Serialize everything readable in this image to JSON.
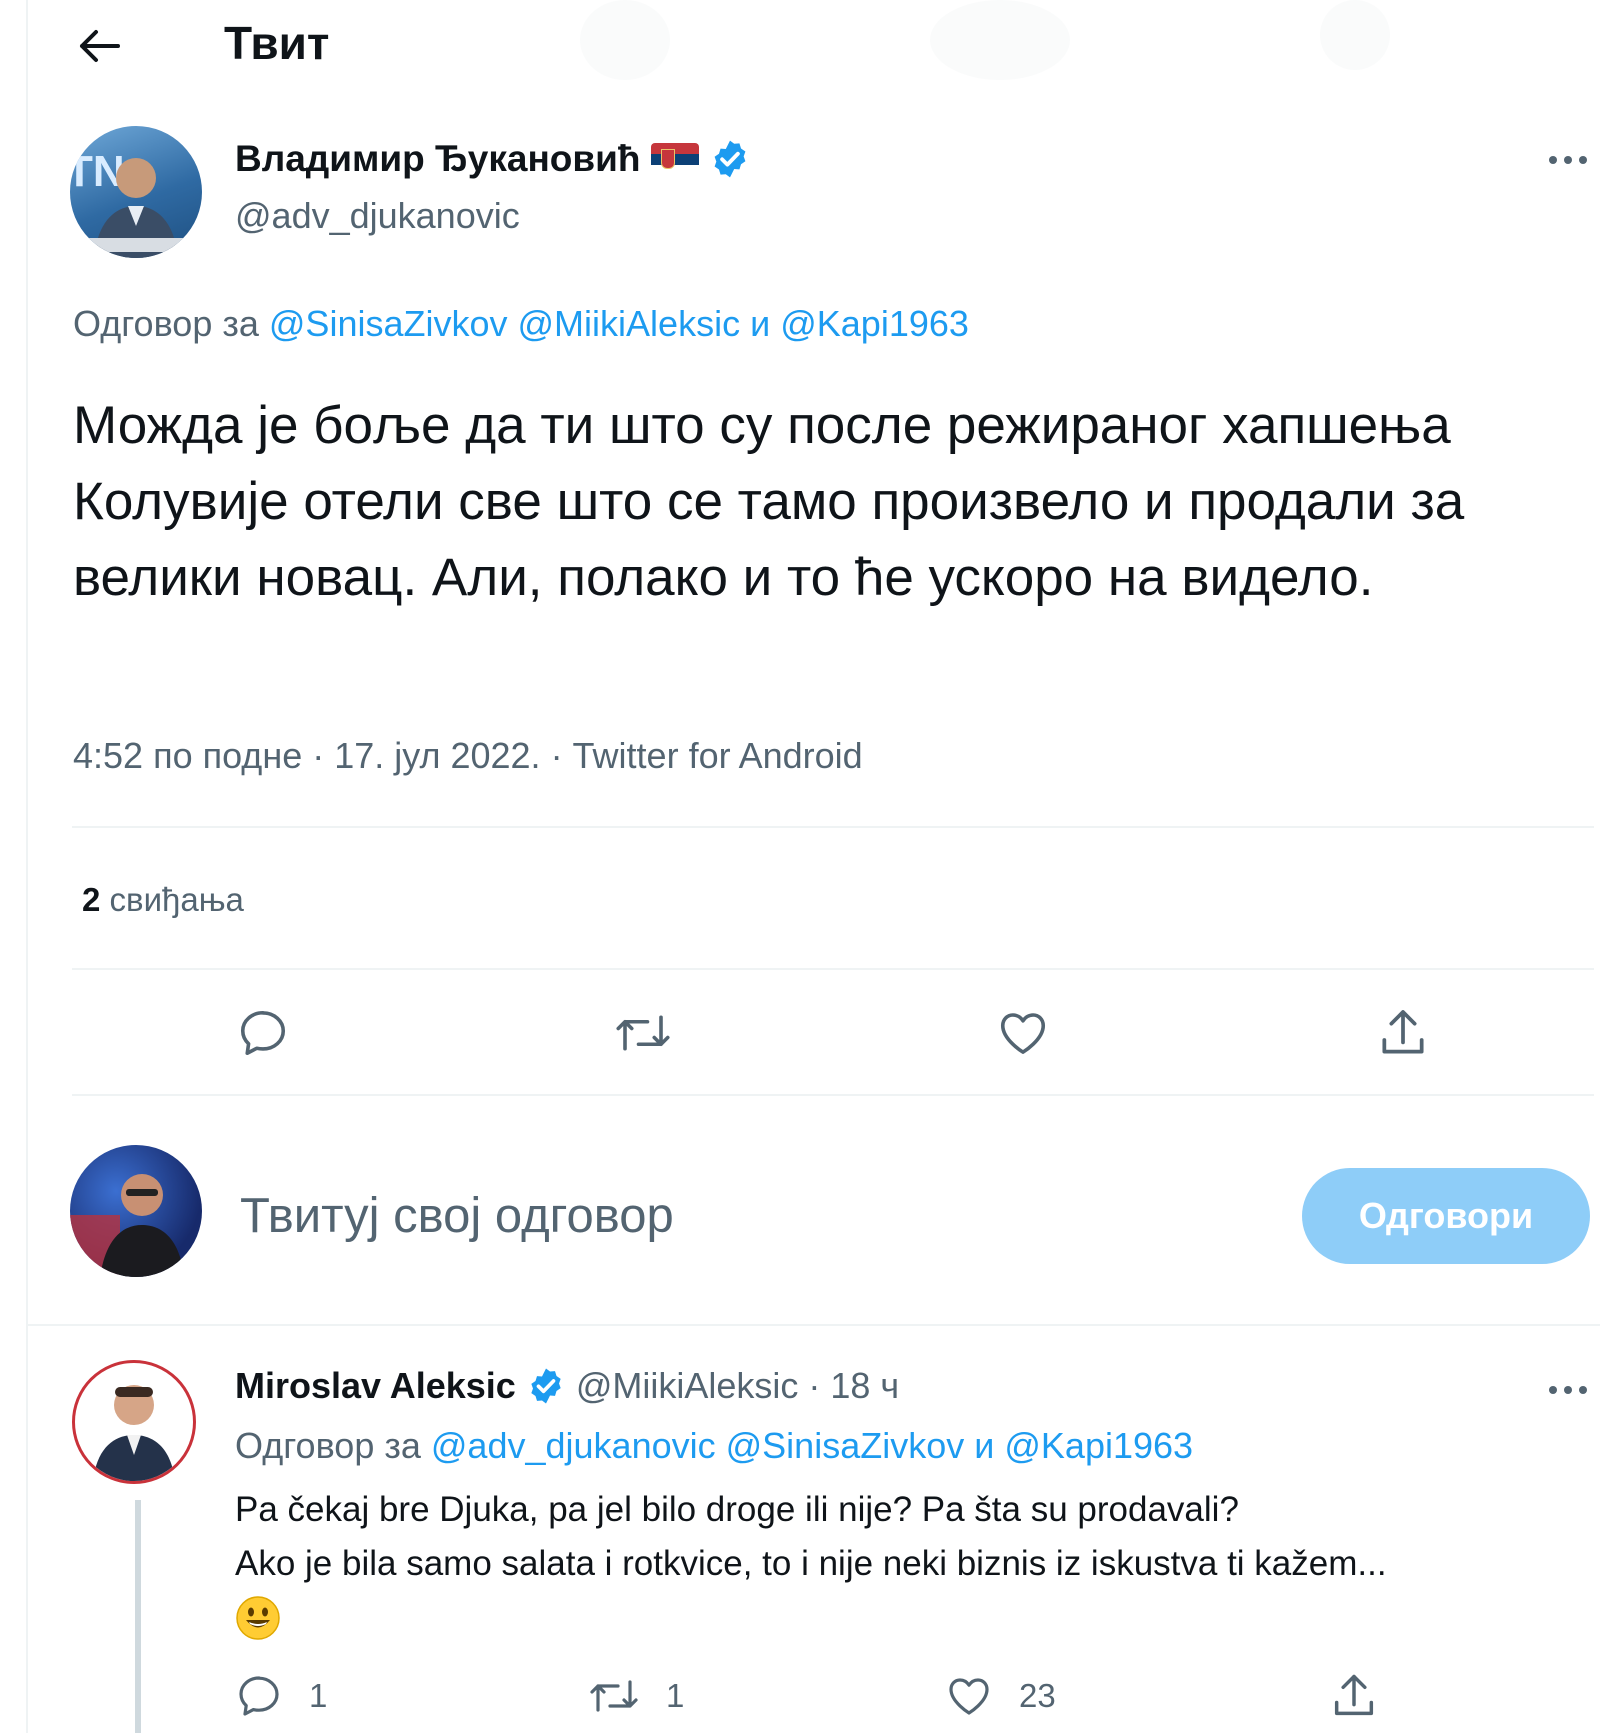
{
  "header": {
    "title": "Твит"
  },
  "tweet": {
    "author": {
      "name": "Владимир Ђукановић",
      "flag_icon": "serbia-flag-icon",
      "verified_icon": "verified-badge-icon",
      "handle": "@adv_djukanovic"
    },
    "reply_to": {
      "prefix": "Одговор за",
      "mention1": "@SinisaZivkov",
      "mention2": "@MiikiAleksic",
      "conj": "и",
      "mention3": "@Kapi1963"
    },
    "text": "Можда је боље да ти што су после режираног хапшења Колувије отели све што се тамо произвело и продали за велики новац. Али, полако и то ће ускоро на видело.",
    "meta": "4:52 по подне · 17. јул 2022. · Twitter for Android",
    "likes": {
      "count": "2",
      "label": "свиђања"
    },
    "actions": [
      "reply-icon",
      "retweet-icon",
      "like-icon",
      "share-icon"
    ]
  },
  "compose": {
    "placeholder": "Твитуј свој одговор",
    "button": "Одговори",
    "button_color": "#8ecdf8"
  },
  "reply": {
    "author": {
      "name": "Miroslav Aleksic",
      "verified_icon": "verified-badge-icon",
      "handle": "@MiikiAleksic",
      "time": "· 18 ч"
    },
    "reply_to": {
      "prefix": "Одговор за",
      "mention1": "@adv_djukanovic",
      "mention2": "@SinisaZivkov",
      "conj": "и",
      "mention3": "@Kapi1963"
    },
    "line1": "Pa čekaj bre Djuka, pa jel bilo droge ili nije? Pa šta su prodavali?",
    "line2": "Ako je bila samo salata i rotkvice, to i nije neki biznis iz iskustva ti kažem...",
    "emoji": "😃",
    "counts": {
      "reply": "1",
      "retweet": "1",
      "like": "23"
    }
  },
  "colors": {
    "accent": "#1d9bf0",
    "muted": "#536471",
    "divider": "#eff3f4"
  }
}
